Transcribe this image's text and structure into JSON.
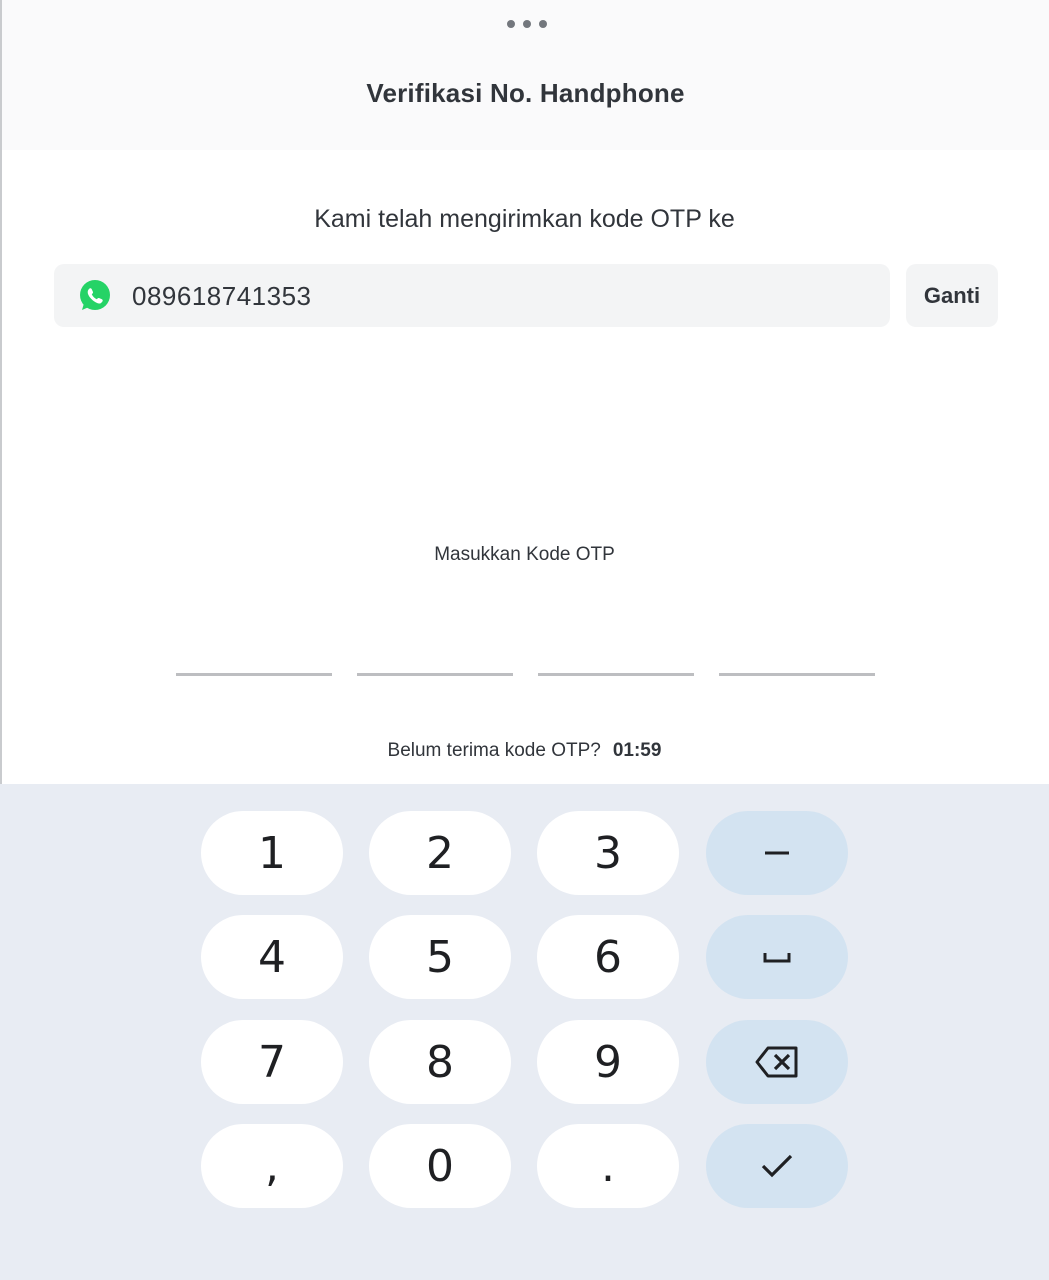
{
  "header": {
    "more_icon": "more-horizontal-icon",
    "title": "Verifikasi No. Handphone"
  },
  "verification": {
    "sent_text": "Kami telah mengirimkan kode OTP ke",
    "channel_icon": "whatsapp-icon",
    "phone_number": "089618741353",
    "change_label": "Ganti"
  },
  "otp": {
    "label": "Masukkan Kode OTP",
    "digits": [
      "",
      "",
      "",
      ""
    ],
    "resend_prompt": "Belum terima kode OTP?",
    "timer": "01:59"
  },
  "keyboard": {
    "keys": {
      "k1": "1",
      "k2": "2",
      "k3": "3",
      "k4": "4",
      "k5": "5",
      "k6": "6",
      "k7": "7",
      "k8": "8",
      "k9": "9",
      "comma": ",",
      "k0": "0",
      "period": "."
    },
    "function_icons": [
      "minus-icon",
      "space-icon",
      "backspace-icon",
      "check-icon"
    ]
  },
  "colors": {
    "whatsapp_green": "#25D366",
    "keyboard_bg": "#E8ECF3",
    "function_key_bg": "#D3E3F1"
  }
}
